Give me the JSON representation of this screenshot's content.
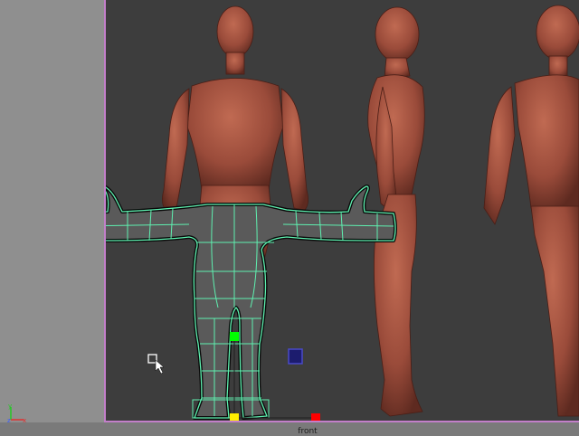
{
  "viewport": {
    "name": "front",
    "background_color": "#3d3d3d",
    "border_color": "#c27fc9"
  },
  "reference_images": [
    {
      "view": "front",
      "skin_color": "#9a4b3a"
    },
    {
      "view": "side",
      "skin_color": "#9a4b3a"
    },
    {
      "view": "back",
      "skin_color": "#9a4b3a"
    }
  ],
  "mesh": {
    "wire_color": "#5ff0b0",
    "fill_color": "#5a5a5a"
  },
  "handles": [
    {
      "name": "green-handle",
      "color": "#00ff00"
    },
    {
      "name": "yellow-handle",
      "color": "#ffee00"
    },
    {
      "name": "red-handle",
      "color": "#ff0000"
    },
    {
      "name": "blue-handle",
      "color": "#1c1c6e"
    }
  ],
  "axis": {
    "y": "y",
    "x": "x",
    "z": "z",
    "y_color": "#26c826",
    "x_color": "#e03030",
    "z_color": "#3a5cff"
  },
  "cursor_icon": "selection-cursor-icon"
}
